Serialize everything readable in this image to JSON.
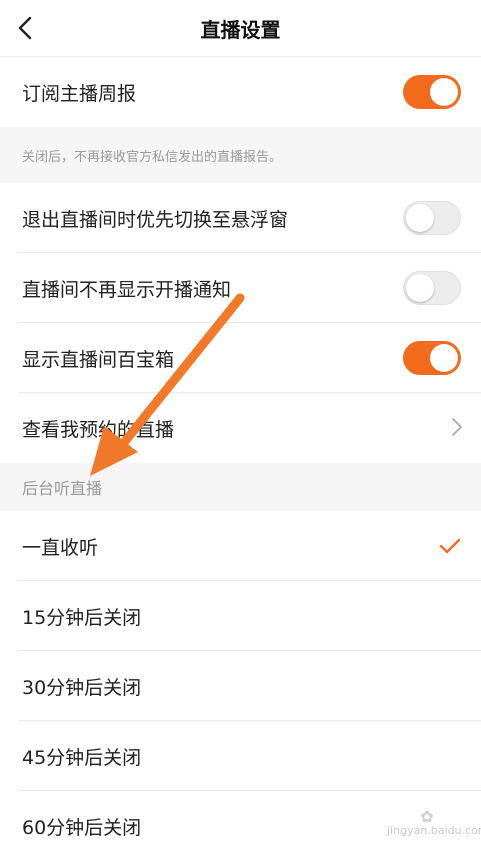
{
  "header": {
    "title": "直播设置"
  },
  "rows": {
    "subscribe_weekly": "订阅主播周报",
    "subscribe_note": "关闭后，不再接收官方私信发出的直播报告。",
    "float_window": "退出直播间时优先切换至悬浮窗",
    "no_live_notice": "直播间不再显示开播通知",
    "show_treasure": "显示直播间百宝箱",
    "view_reserved": "查看我预约的直播"
  },
  "section": {
    "background_listen": "后台听直播"
  },
  "options": [
    "一直收听",
    "15分钟后关闭",
    "30分钟后关闭",
    "45分钟后关闭",
    "60分钟后关闭"
  ],
  "toggles": {
    "subscribe_weekly": "on",
    "float_window": "off",
    "no_live_notice": "off",
    "show_treasure": "on"
  },
  "watermark": {
    "text": "jingyan.baidu.com"
  },
  "colors": {
    "accent": "#f26a1c"
  }
}
